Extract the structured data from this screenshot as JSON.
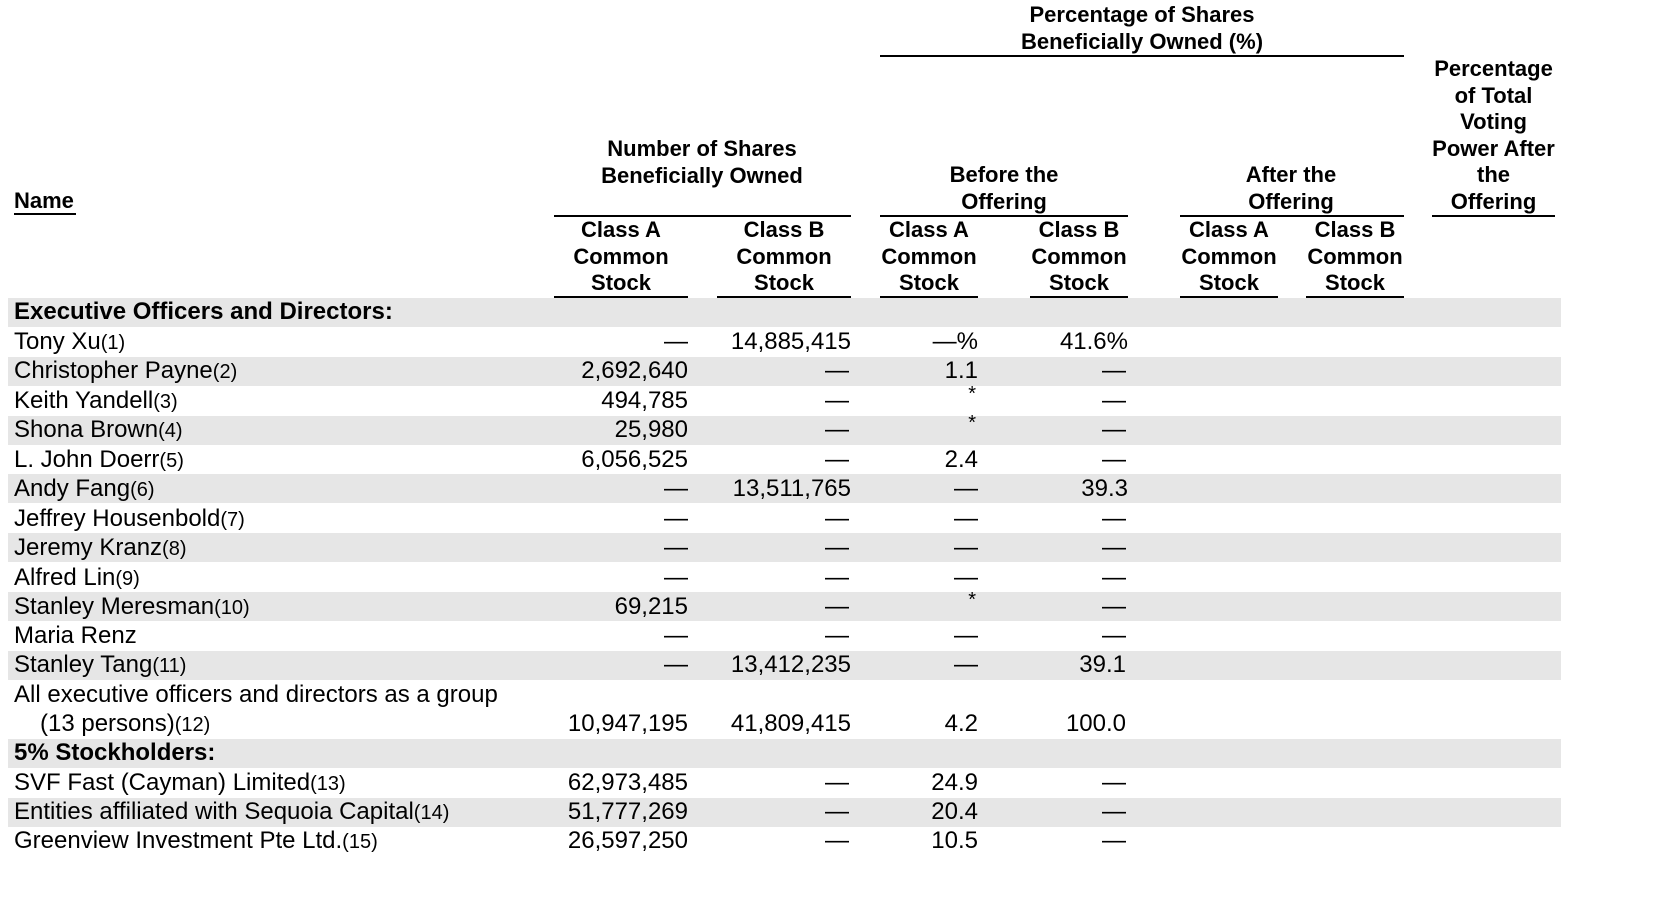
{
  "header": {
    "name": "Name",
    "shares_owned": "Number of Shares Beneficially Owned",
    "pct_owned": "Percentage of Shares Beneficially Owned (%)",
    "before": "Before the Offering",
    "after": "After the Offering",
    "voting": "Percentage of Total Voting Power After the Offering",
    "class_a": "Class A Common Stock",
    "class_b": "Class B Common Stock"
  },
  "sections": {
    "officers": "Executive Officers and Directors:",
    "holders": "5% Stockholders:"
  },
  "rows": [
    {
      "name": "Tony Xu",
      "fn": "(1)",
      "a": "—",
      "b": "14,885,415",
      "pa": "—%",
      "pb": "41.6%"
    },
    {
      "name": "Christopher Payne",
      "fn": "(2)",
      "a": "2,692,640",
      "b": "—",
      "pa": "1.1",
      "pb": "—"
    },
    {
      "name": "Keith Yandell",
      "fn": "(3)",
      "a": "494,785",
      "b": "—",
      "pa": "*",
      "pb": "—"
    },
    {
      "name": "Shona Brown",
      "fn": "(4)",
      "a": "25,980",
      "b": "—",
      "pa": "*",
      "pb": "—"
    },
    {
      "name": "L. John Doerr",
      "fn": "(5)",
      "a": "6,056,525",
      "b": "—",
      "pa": "2.4",
      "pb": "—"
    },
    {
      "name": "Andy Fang",
      "fn": "(6)",
      "a": "—",
      "b": "13,511,765",
      "pa": "—",
      "pb": "39.3"
    },
    {
      "name": "Jeffrey Housenbold",
      "fn": "(7)",
      "a": "—",
      "b": "—",
      "pa": "—",
      "pb": "—"
    },
    {
      "name": "Jeremy Kranz",
      "fn": "(8)",
      "a": "—",
      "b": "—",
      "pa": "—",
      "pb": "—"
    },
    {
      "name": "Alfred Lin",
      "fn": "(9)",
      "a": "—",
      "b": "—",
      "pa": "—",
      "pb": "—"
    },
    {
      "name": "Stanley Meresman",
      "fn": "(10)",
      "a": "69,215",
      "b": "—",
      "pa": "*",
      "pb": "—"
    },
    {
      "name": "Maria Renz",
      "fn": "",
      "a": "—",
      "b": "—",
      "pa": "—",
      "pb": "—"
    },
    {
      "name": "Stanley Tang",
      "fn": "(11)",
      "a": "—",
      "b": "13,412,235",
      "pa": "—",
      "pb": "39.1"
    }
  ],
  "group_row": {
    "line1": "All executive officers and directors as a group",
    "line2": "(13 persons)",
    "fn": "(12)",
    "a": "10,947,195",
    "b": "41,809,415",
    "pa": "4.2",
    "pb": "100.0"
  },
  "holders": [
    {
      "name": "SVF Fast (Cayman) Limited",
      "fn": "(13)",
      "a": "62,973,485",
      "b": "—",
      "pa": "24.9",
      "pb": "—"
    },
    {
      "name": "Entities affiliated with Sequoia Capital",
      "fn": "(14)",
      "a": "51,777,269",
      "b": "—",
      "pa": "20.4",
      "pb": "—"
    },
    {
      "name": "Greenview Investment Pte Ltd.",
      "fn": "(15)",
      "a": "26,597,250",
      "b": "—",
      "pa": "10.5",
      "pb": "—"
    }
  ]
}
